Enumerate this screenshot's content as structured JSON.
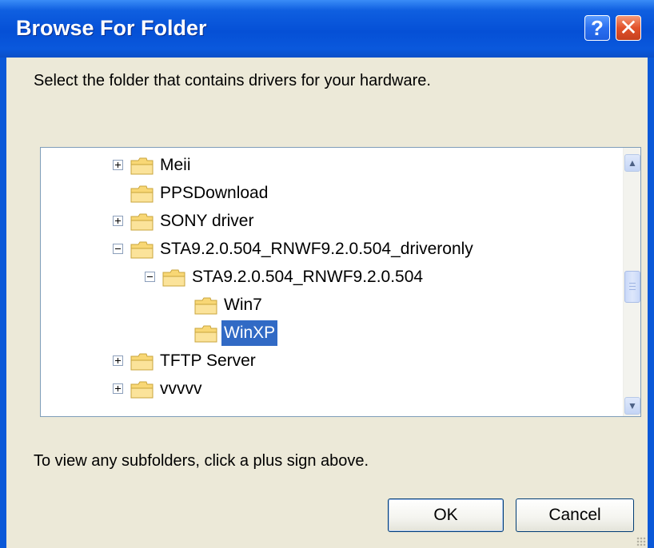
{
  "window": {
    "title": "Browse For Folder",
    "help_glyph": "?",
    "close_glyph": "✕"
  },
  "instruction": "Select the folder that contains drivers for your hardware.",
  "tree": {
    "items": [
      {
        "label": "Meii",
        "expander": "plus",
        "level": 0,
        "selected": false
      },
      {
        "label": "PPSDownload",
        "expander": "none",
        "level": 0,
        "selected": false
      },
      {
        "label": "SONY driver",
        "expander": "plus",
        "level": 0,
        "selected": false
      },
      {
        "label": "STA9.2.0.504_RNWF9.2.0.504_driveronly",
        "expander": "minus",
        "level": 0,
        "selected": false
      },
      {
        "label": "STA9.2.0.504_RNWF9.2.0.504",
        "expander": "minus",
        "level": 1,
        "selected": false
      },
      {
        "label": "Win7",
        "expander": "none",
        "level": 2,
        "selected": false
      },
      {
        "label": "WinXP",
        "expander": "none",
        "level": 2,
        "selected": true
      },
      {
        "label": "TFTP Server",
        "expander": "plus",
        "level": 0,
        "selected": false
      },
      {
        "label": "vvvvv",
        "expander": "plus",
        "level": 0,
        "selected": false
      }
    ]
  },
  "hint": "To view any subfolders, click a plus sign above.",
  "buttons": {
    "ok": "OK",
    "cancel": "Cancel"
  },
  "colors": {
    "selection": "#316ac5",
    "folder_fill": "#f8d775",
    "folder_edge": "#c9a43c"
  }
}
